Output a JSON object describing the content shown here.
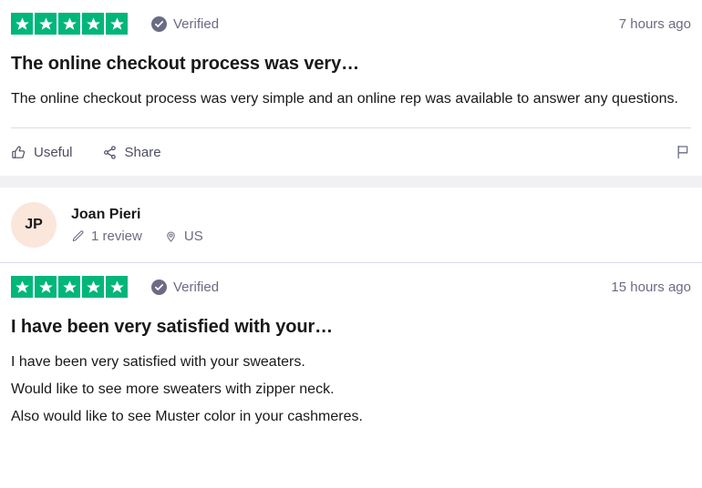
{
  "theme": {
    "star_green": "#00B67A",
    "verified_slate": "#6B6B85",
    "avatar_peach": "#FBE6DC",
    "text_dark": "#191919",
    "divider": "#DCDCE6",
    "gap_band": "#F1F1F4"
  },
  "reviews": [
    {
      "rating": 5,
      "rating_label": "Rated 5 out of 5 stars",
      "verified_label": "Verified",
      "timestamp": "7 hours ago",
      "title": "The online checkout process was very…",
      "body_lines": [
        "The online checkout process was very simple and an online rep was available to answer any questions."
      ],
      "actions": {
        "useful_label": "Useful",
        "share_label": "Share"
      }
    },
    {
      "consumer": {
        "initials": "JP",
        "name": "Joan Pieri",
        "review_count": "1 review",
        "location": "US"
      },
      "rating": 5,
      "rating_label": "Rated 5 out of 5 stars",
      "verified_label": "Verified",
      "timestamp": "15 hours ago",
      "title": "I have been very satisfied with your…",
      "body_lines": [
        "I have been very satisfied with your sweaters.",
        "Would like to see more sweaters with zipper neck.",
        "Also would like to see Muster color in your cashmeres."
      ]
    }
  ]
}
